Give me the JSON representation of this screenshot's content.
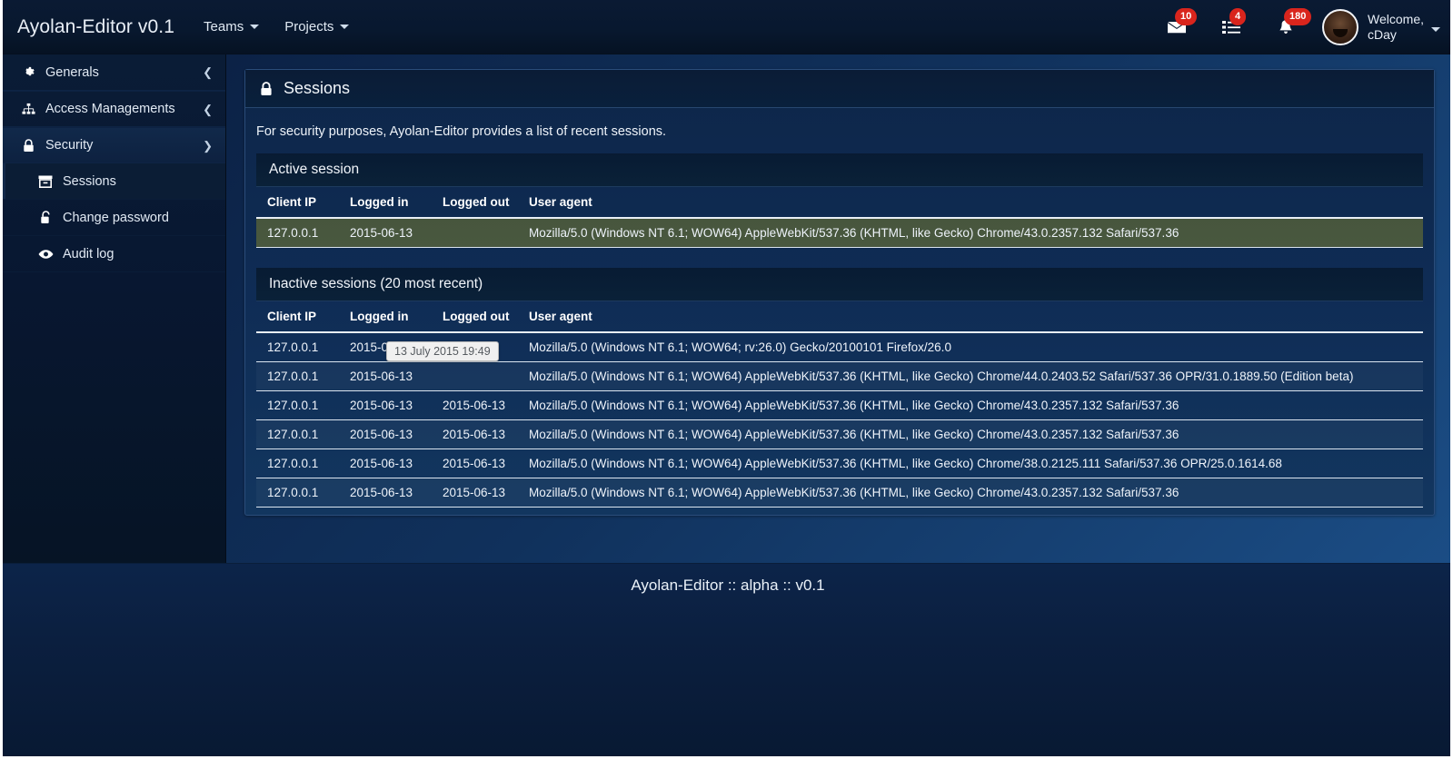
{
  "navbar": {
    "brand": "Ayolan-Editor v0.1",
    "links": [
      {
        "label": "Teams",
        "icon": "chevron-down-icon"
      },
      {
        "label": "Projects",
        "icon": "chevron-down-icon"
      }
    ],
    "indicators": [
      {
        "icon": "envelope-icon",
        "count": "10"
      },
      {
        "icon": "tasks-icon",
        "count": "4"
      },
      {
        "icon": "bell-icon",
        "count": "180"
      }
    ],
    "user": {
      "greeting": "Welcome,",
      "name": "cDay",
      "avatar": "avatar",
      "caret": "chevron-down-icon"
    }
  },
  "sidebar": {
    "items": [
      {
        "label": "Generals",
        "icon": "gear-icon",
        "chevron": "chevron-left-icon",
        "expanded": false
      },
      {
        "label": "Access Managements",
        "icon": "sitemap-icon",
        "chevron": "chevron-left-icon",
        "expanded": false
      },
      {
        "label": "Security",
        "icon": "lock-icon",
        "chevron": "chevron-down-icon",
        "expanded": true
      }
    ],
    "subitems": [
      {
        "label": "Sessions",
        "icon": "archive-icon",
        "active": true
      },
      {
        "label": "Change password",
        "icon": "unlock-icon",
        "active": false
      },
      {
        "label": "Audit log",
        "icon": "eye-icon",
        "active": false
      }
    ]
  },
  "page": {
    "title": "Sessions",
    "title_icon": "lock-icon",
    "intro": "For security purposes, Ayolan-Editor provides a list of recent sessions."
  },
  "active_section": {
    "heading": "Active session",
    "columns": [
      "Client IP",
      "Logged in",
      "Logged out",
      "User agent"
    ],
    "rows": [
      {
        "ip": "127.0.0.1",
        "logged_in": "2015-06-13",
        "logged_out": "",
        "user_agent": "Mozilla/5.0 (Windows NT 6.1; WOW64) AppleWebKit/537.36 (KHTML, like Gecko) Chrome/43.0.2357.132 Safari/537.36"
      }
    ]
  },
  "inactive_section": {
    "heading": "Inactive sessions (20 most recent)",
    "columns": [
      "Client IP",
      "Logged in",
      "Logged out",
      "User agent"
    ],
    "rows": [
      {
        "ip": "127.0.0.1",
        "logged_in": "2015-06-13",
        "logged_out": "",
        "user_agent": "Mozilla/5.0 (Windows NT 6.1; WOW64; rv:26.0) Gecko/20100101 Firefox/26.0"
      },
      {
        "ip": "127.0.0.1",
        "logged_in": "2015-06-13",
        "logged_out": "",
        "user_agent": "Mozilla/5.0 (Windows NT 6.1; WOW64) AppleWebKit/537.36 (KHTML, like Gecko) Chrome/44.0.2403.52 Safari/537.36 OPR/31.0.1889.50 (Edition beta)"
      },
      {
        "ip": "127.0.0.1",
        "logged_in": "2015-06-13",
        "logged_out": "2015-06-13",
        "user_agent": "Mozilla/5.0 (Windows NT 6.1; WOW64) AppleWebKit/537.36 (KHTML, like Gecko) Chrome/43.0.2357.132 Safari/537.36"
      },
      {
        "ip": "127.0.0.1",
        "logged_in": "2015-06-13",
        "logged_out": "2015-06-13",
        "user_agent": "Mozilla/5.0 (Windows NT 6.1; WOW64) AppleWebKit/537.36 (KHTML, like Gecko) Chrome/43.0.2357.132 Safari/537.36"
      },
      {
        "ip": "127.0.0.1",
        "logged_in": "2015-06-13",
        "logged_out": "2015-06-13",
        "user_agent": "Mozilla/5.0 (Windows NT 6.1; WOW64) AppleWebKit/537.36 (KHTML, like Gecko) Chrome/38.0.2125.111 Safari/537.36 OPR/25.0.1614.68"
      },
      {
        "ip": "127.0.0.1",
        "logged_in": "2015-06-13",
        "logged_out": "2015-06-13",
        "user_agent": "Mozilla/5.0 (Windows NT 6.1; WOW64) AppleWebKit/537.36 (KHTML, like Gecko) Chrome/43.0.2357.132 Safari/537.36"
      }
    ]
  },
  "tooltip": {
    "text": "13 July 2015 19:49"
  },
  "footer": {
    "text": "Ayolan-Editor :: alpha :: v0.1"
  },
  "colors": {
    "badge": "#d9251d",
    "navbar_bg": "#08182f",
    "sidebar_bg": "#081731",
    "active_row": "#47563d",
    "panel_bg": "#0f2c55"
  }
}
